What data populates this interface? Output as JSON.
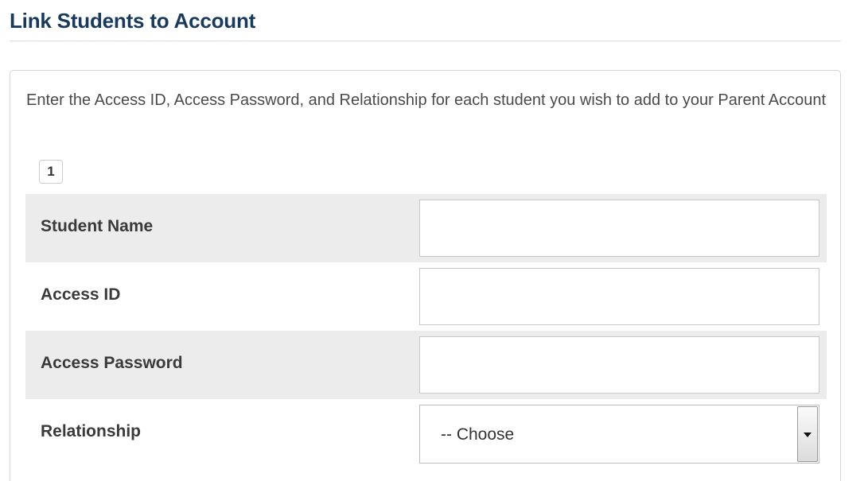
{
  "page": {
    "title": "Link Students to Account"
  },
  "panel": {
    "instructions": "Enter the Access ID, Access Password, and Relationship for each student you wish to add to your Parent Account",
    "step_number": "1"
  },
  "form": {
    "fields": [
      {
        "label": "Student Name",
        "value": ""
      },
      {
        "label": "Access ID",
        "value": ""
      },
      {
        "label": "Access Password",
        "value": ""
      },
      {
        "label": "Relationship",
        "selected": "-- Choose"
      }
    ]
  },
  "colors": {
    "title": "#173a5e",
    "shaded_row": "#ececec",
    "border": "#d4d4d4"
  },
  "icons": {
    "relationship_select": "chevron-down-icon"
  }
}
